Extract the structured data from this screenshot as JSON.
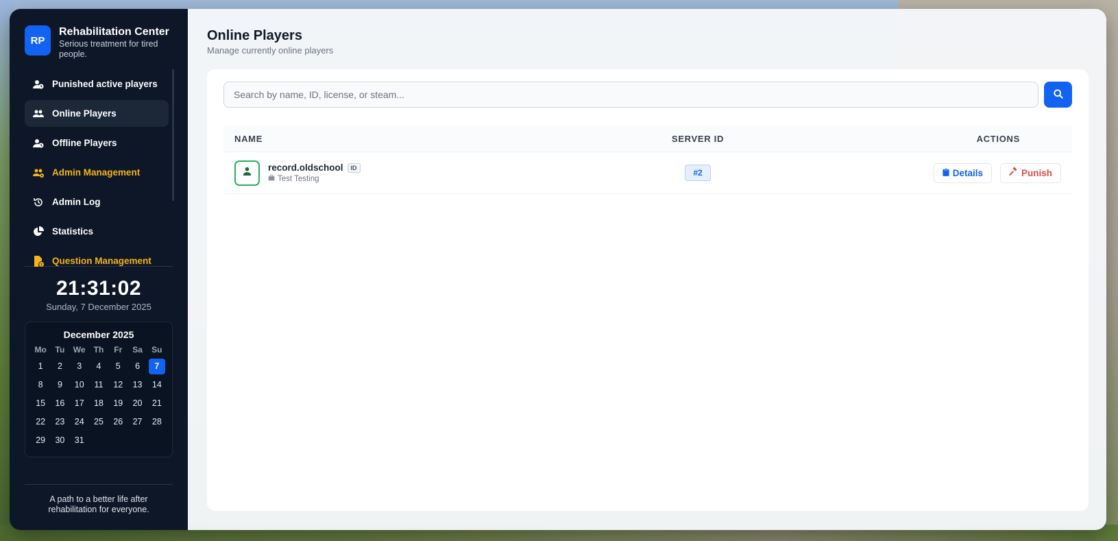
{
  "brand": {
    "logo_text": "RP",
    "title": "Rehabilitation Center",
    "subtitle": "Serious treatment for tired people."
  },
  "nav": {
    "items": [
      {
        "label": "Punished active players",
        "icon": "user-clock-icon",
        "highlight": false
      },
      {
        "label": "Online Players",
        "icon": "users-icon",
        "highlight": false,
        "active": true
      },
      {
        "label": "Offline Players",
        "icon": "user-clock-icon",
        "highlight": false
      },
      {
        "label": "Admin Management",
        "icon": "users-cog-icon",
        "highlight": true
      },
      {
        "label": "Admin Log",
        "icon": "history-icon",
        "highlight": false
      },
      {
        "label": "Statistics",
        "icon": "pie-chart-icon",
        "highlight": false
      },
      {
        "label": "Question Management",
        "icon": "file-question-icon",
        "highlight": true
      }
    ]
  },
  "clock": {
    "time": "21:31:02",
    "date": "Sunday, 7 December 2025"
  },
  "calendar": {
    "title": "December 2025",
    "weekdays": [
      "Mo",
      "Tu",
      "We",
      "Th",
      "Fr",
      "Sa",
      "Su"
    ],
    "days": [
      "1",
      "2",
      "3",
      "4",
      "5",
      "6",
      "7",
      "8",
      "9",
      "10",
      "11",
      "12",
      "13",
      "14",
      "15",
      "16",
      "17",
      "18",
      "19",
      "20",
      "21",
      "22",
      "23",
      "24",
      "25",
      "26",
      "27",
      "28",
      "29",
      "30",
      "31"
    ],
    "today": "7"
  },
  "footer": {
    "text": "A path to a better life after rehabilitation for everyone."
  },
  "page": {
    "title": "Online Players",
    "subtitle": "Manage currently online players"
  },
  "search": {
    "placeholder": "Search by name, ID, license, or steam...",
    "value": ""
  },
  "table": {
    "headers": {
      "name": "NAME",
      "server_id": "SERVER ID",
      "actions": "ACTIONS"
    },
    "rows": [
      {
        "name": "record.oldschool",
        "id_badge": "ID",
        "job": "Test Testing",
        "server_id": "#2",
        "details_label": "Details",
        "punish_label": "Punish"
      }
    ]
  },
  "colors": {
    "accent": "#1263f1",
    "sidebar_bg": "#0d1727",
    "warn": "#f6b31a",
    "danger": "#e14b4b",
    "online": "#22b25a"
  }
}
